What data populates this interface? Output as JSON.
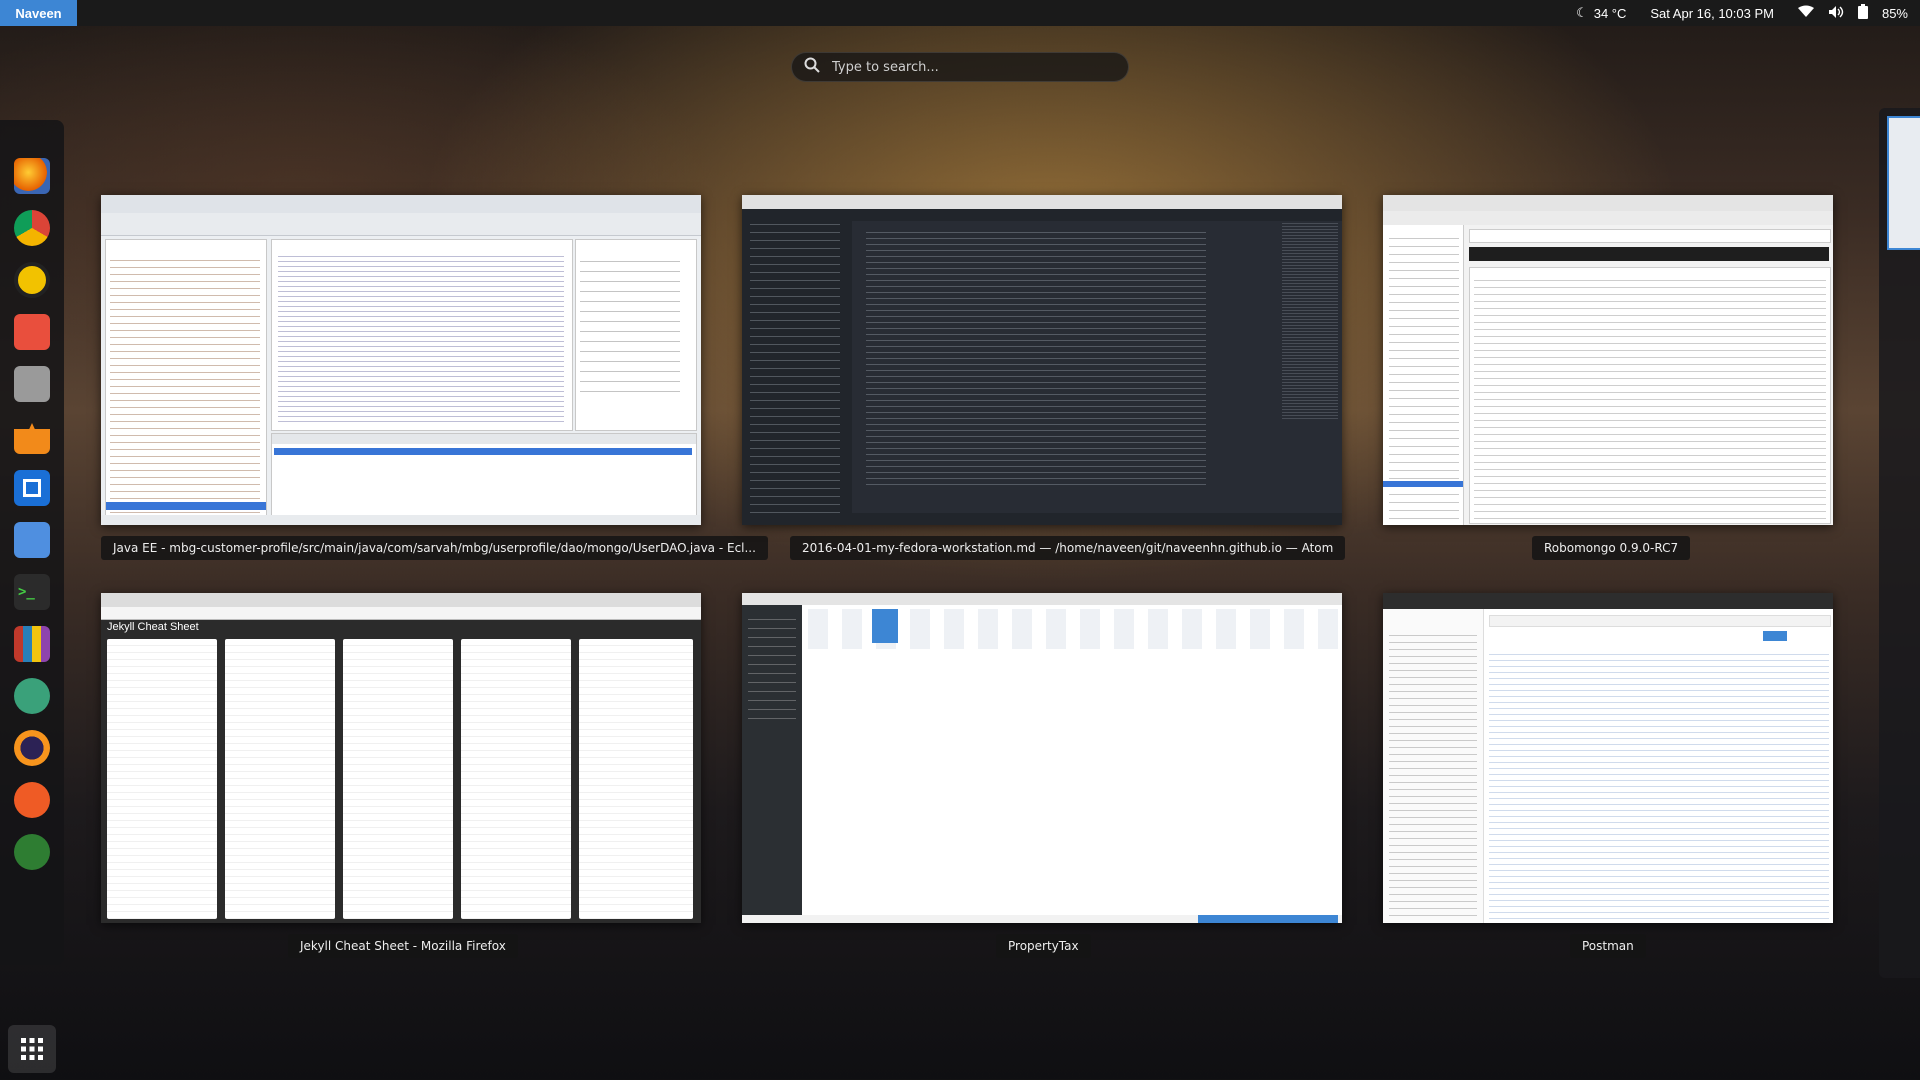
{
  "topbar": {
    "user": "Naveen",
    "weather": "34 °C",
    "datetime": "Sat Apr 16, 10:03 PM",
    "battery": "85%"
  },
  "search": {
    "placeholder": "Type to search..."
  },
  "dash": {
    "items": [
      "firefox-icon",
      "chrome-icon",
      "rhythmbox-icon",
      "software-center-icon",
      "files-icon",
      "vlc-icon",
      "slack-icon",
      "document-icon",
      "terminal-icon",
      "library-icon",
      "atom-icon",
      "eclipse-icon",
      "postman-icon",
      "robomongo-icon"
    ],
    "apps_icon": "show-applications-icon"
  },
  "windows": [
    {
      "title": "Java EE - mbg-customer-profile/src/main/java/com/sarvah/mbg/userprofile/dao/mongo/UserDAO.java - Ecl..."
    },
    {
      "title": "2016-04-01-my-fedora-workstation.md — /home/naveen/git/naveenhn.github.io — Atom"
    },
    {
      "title": "Robomongo 0.9.0-RC7"
    },
    {
      "title": "Jekyll Cheat Sheet - Mozilla Firefox"
    },
    {
      "title": "PropertyTax"
    },
    {
      "title": "Postman"
    }
  ],
  "thumbs": {
    "jekyll_heading": "Jekyll Cheat Sheet"
  },
  "colors": {
    "accent": "#3d86d4",
    "topbar": "#1a1a1a"
  }
}
